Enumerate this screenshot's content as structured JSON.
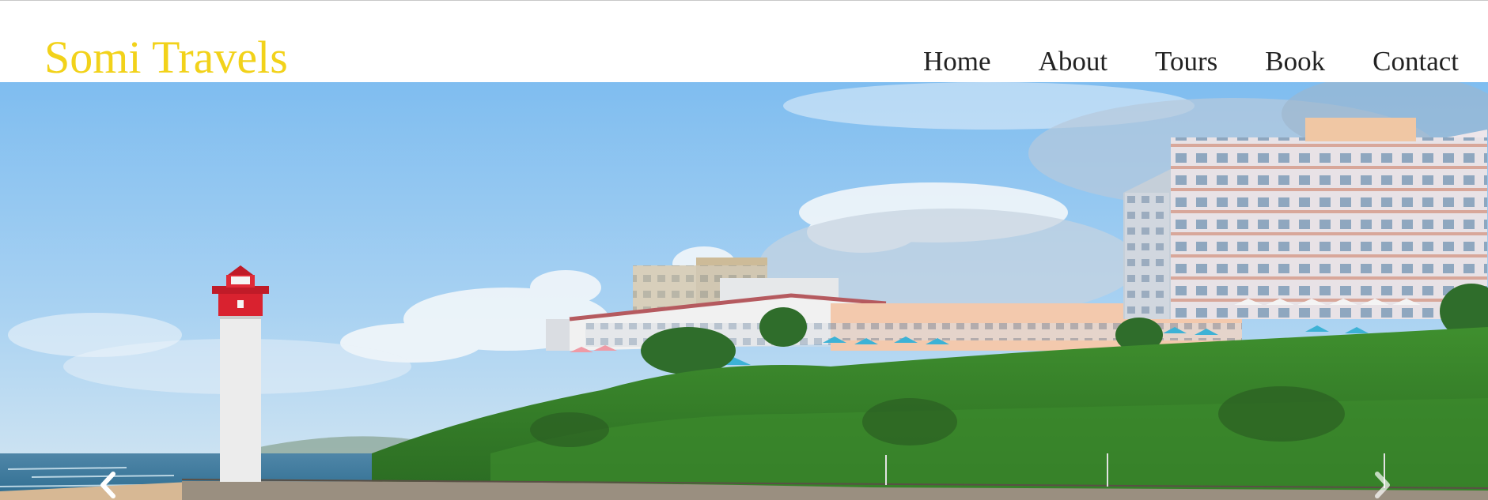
{
  "header": {
    "brand": "Somi Travels",
    "nav": [
      "Home",
      "About",
      "Tours",
      "Book",
      "Contact"
    ]
  },
  "hero": {
    "prev_icon": "chevron-left-icon",
    "next_icon": "chevron-right-icon"
  },
  "colors": {
    "brand": "#f2d21a",
    "nav_text": "#222222",
    "sky": "#8cc2ee",
    "lighthouse_red": "#d9222f"
  }
}
